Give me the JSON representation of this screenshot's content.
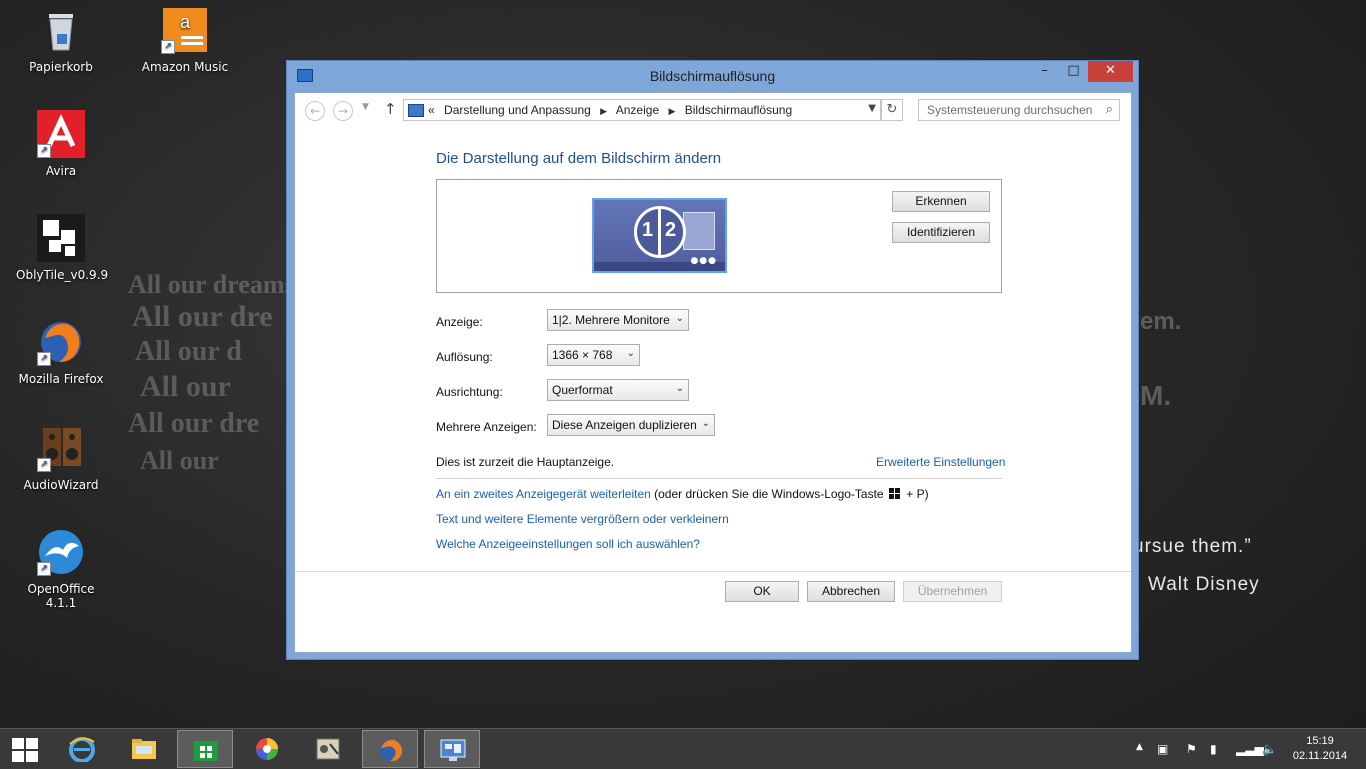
{
  "desktop": {
    "icons": [
      {
        "label": "Papierkorb"
      },
      {
        "label": "Amazon Music"
      },
      {
        "label": "Avira"
      },
      {
        "label": "OblyTile_v0.9.9"
      },
      {
        "label": "Mozilla Firefox"
      },
      {
        "label": "AudioWizard"
      },
      {
        "label": "OpenOffice 4.1.1"
      }
    ],
    "wallpaper": {
      "quote_end": "ursue them.”",
      "author": "Walt Disney",
      "faint_1": "em.",
      "faint_2": "M."
    }
  },
  "window": {
    "title": "Bildschirmauflösung",
    "controls": {
      "minimize": "–",
      "maximize": "□",
      "close": "✕"
    },
    "address": {
      "prefix": "«",
      "crumbs": [
        "Darstellung und Anpassung",
        "Anzeige",
        "Bildschirmauflösung"
      ]
    },
    "search_placeholder": "Systemsteuerung durchsuchen",
    "heading": "Die Darstellung auf dem Bildschirm ändern",
    "preview": {
      "monitor_left": "1",
      "monitor_right": "2"
    },
    "buttons": {
      "detect": "Erkennen",
      "identify": "Identifizieren"
    },
    "fields": {
      "display": {
        "label": "Anzeige:",
        "value": "1|2. Mehrere Monitore"
      },
      "resolution": {
        "label": "Auflösung:",
        "value": "1366 × 768"
      },
      "orientation": {
        "label": "Ausrichtung:",
        "value": "Querformat"
      },
      "multiple": {
        "label": "Mehrere Anzeigen:",
        "value": "Diese Anzeigen duplizieren"
      }
    },
    "main_display_text": "Dies ist zurzeit die Hauptanzeige.",
    "advanced_link": "Erweiterte Einstellungen",
    "project_link": "An ein zweites Anzeigegerät weiterleiten",
    "project_hint_1": "(oder drücken Sie die Windows-Logo-Taste",
    "project_hint_2": "+ P)",
    "text_size_link": "Text und weitere Elemente vergrößern oder verkleinern",
    "which_settings_link": "Welche Anzeigeeinstellungen soll ich auswählen?",
    "footer": {
      "ok": "OK",
      "cancel": "Abbrechen",
      "apply": "Übernehmen"
    }
  },
  "taskbar": {
    "apps": [
      "start",
      "internet-explorer",
      "file-explorer",
      "store",
      "color-app",
      "audio-wizard",
      "firefox",
      "control-panel"
    ],
    "clock": {
      "time": "15:19",
      "date": "02.11.2014"
    }
  }
}
